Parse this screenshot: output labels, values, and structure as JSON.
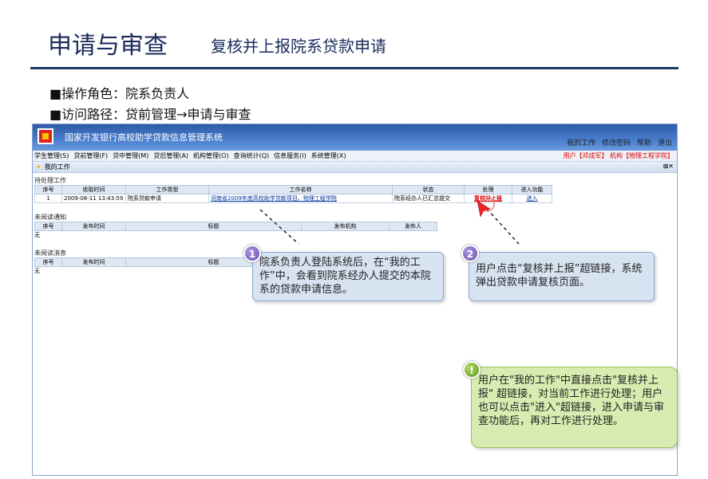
{
  "slide": {
    "title": "申请与审查",
    "subtitle": "复核并上报院系贷款申请",
    "bullets": [
      "■操作角色：院系负责人",
      "■访问路径：贷前管理→申请与审查"
    ]
  },
  "app": {
    "name": "国家开发银行高校助学贷款信息管理系统",
    "header_links": [
      "我的工作",
      "修改密码",
      "帮助",
      "退出"
    ],
    "menu": [
      "学生管理(S)",
      "贷前管理(F)",
      "贷中管理(M)",
      "贷后管理(A)",
      "机构管理(O)",
      "查询统计(Q)",
      "信息服务(I)",
      "系统管理(X)"
    ],
    "user_info": "用户【邓成军】 机构【物理工程学院】",
    "panel_title": "我的工作",
    "pending": {
      "title": "待处理工作",
      "headers": [
        "序号",
        "收取时间",
        "工作类型",
        "工作名称",
        "状态",
        "处理",
        "进入功能"
      ],
      "rows": [
        [
          "1",
          "2009-08-11 13:43:59",
          "院系贷款申请",
          "河南省2009年度高校助学贷款项目、物理工程学院",
          "院系经办人已汇总提交",
          "复核并上报",
          "进入"
        ]
      ]
    },
    "notices": {
      "title": "未阅读通知",
      "headers": [
        "序号",
        "发布时间",
        "标题",
        "发布机构",
        "发布人"
      ],
      "empty": "无"
    },
    "messages": {
      "title": "未阅读消息",
      "headers": [
        "序号",
        "发布时间",
        "标题"
      ],
      "empty": "无"
    }
  },
  "callouts": {
    "c1": {
      "num": "1",
      "text": "院系负责人登陆系统后，在“我的工作”中，会看到院系经办人提交的本院系的贷款申请信息。"
    },
    "c2": {
      "num": "2",
      "text": "用户点击“复核并上报”超链接，系统弹出贷款申请复核页面。"
    },
    "c3": {
      "num": "!",
      "text": "用户在\"我的工作\"中直接点击\"复核并上报\" 超链接，对当前工作进行处理；用户也可以点击\"进入\"超链接，进入申请与审查功能后，再对工作进行处理。"
    }
  },
  "colors": {
    "accent": "#1f3864",
    "header": "#2d5aa8",
    "link": "#003399",
    "action": "#dd0000"
  }
}
